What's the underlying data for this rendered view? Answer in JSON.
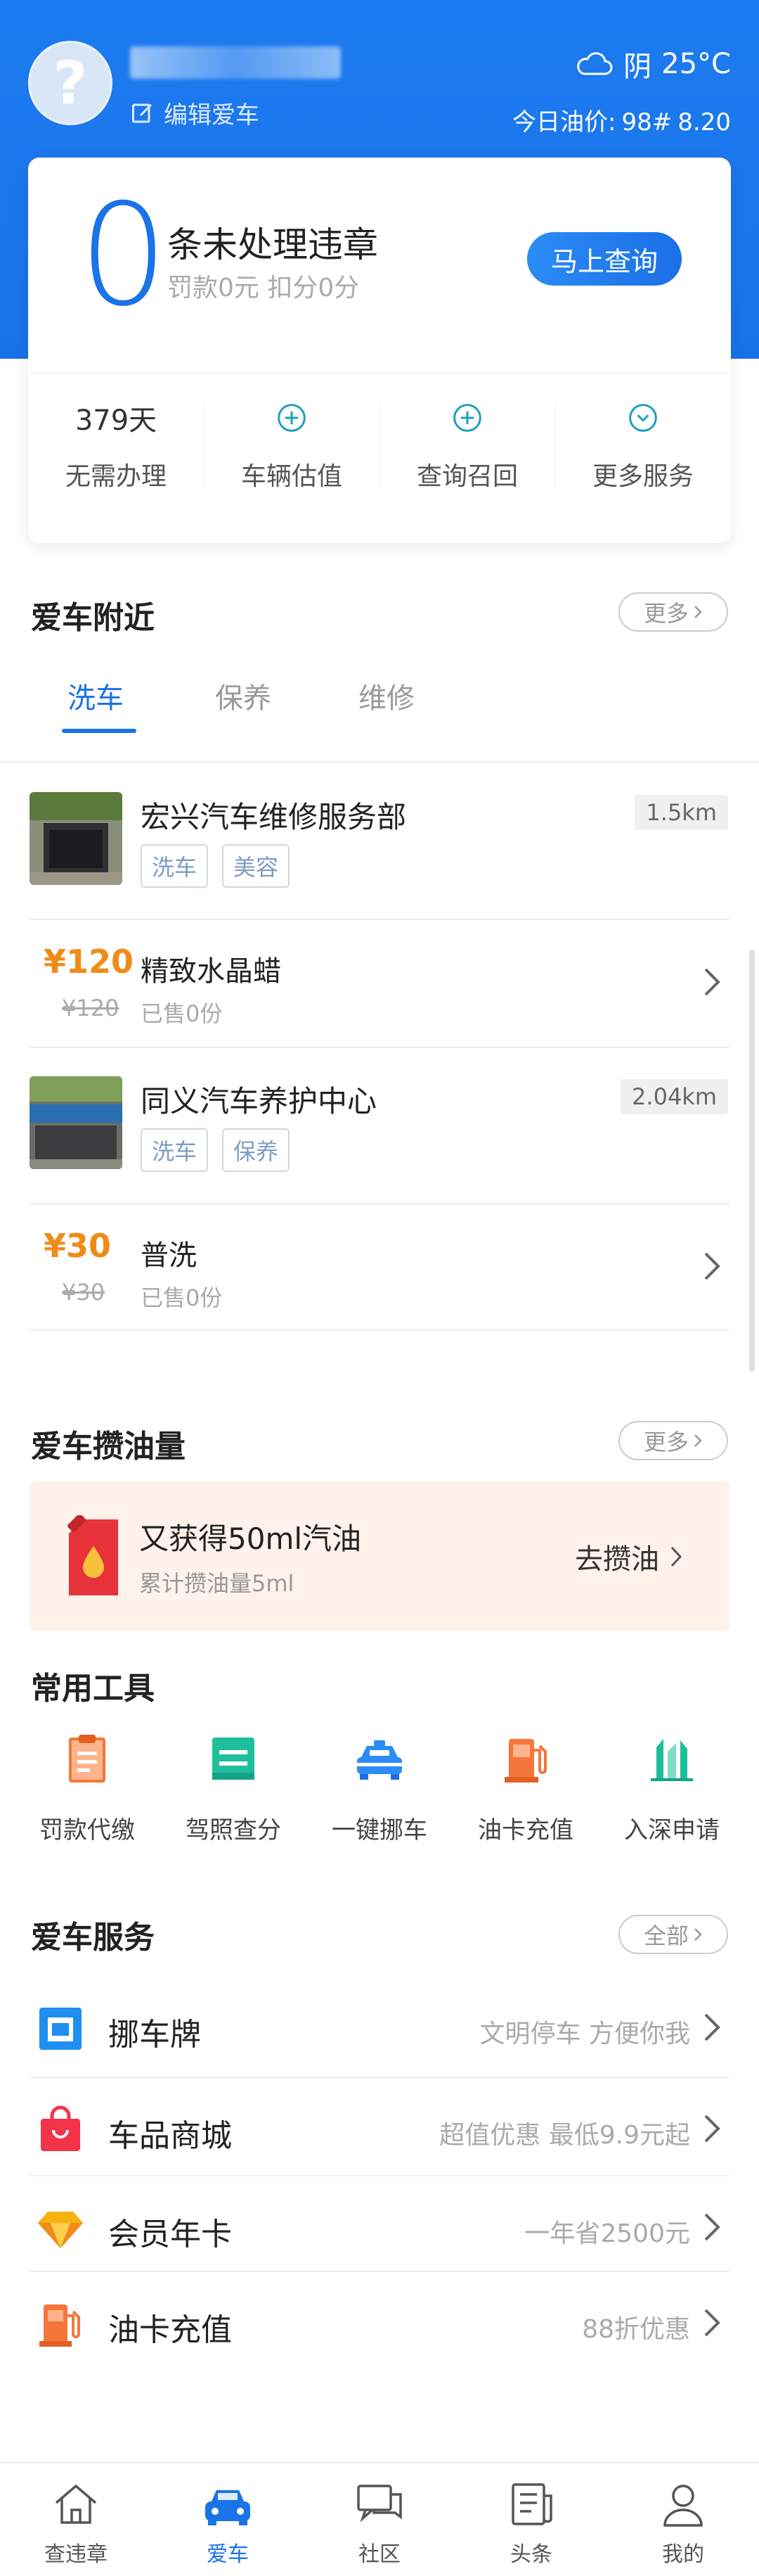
{
  "header": {
    "avatar_glyph": "?",
    "edit_label": "编辑爱车",
    "weather": {
      "condition": "阴",
      "temp": "25°C"
    },
    "oil_price": {
      "label": "今日油价:",
      "grade": "98#",
      "price": "8.20"
    }
  },
  "violation": {
    "count": "0",
    "title": "条未处理违章",
    "fine_summary": "罚款0元 扣分0分",
    "query_button": "马上查询",
    "quick": [
      {
        "top": "379天",
        "label": "无需办理"
      },
      {
        "top": "",
        "label": "车辆估值",
        "icon": "plus-circle-icon"
      },
      {
        "top": "",
        "label": "查询召回",
        "icon": "plus-circle-icon"
      },
      {
        "top": "",
        "label": "更多服务",
        "icon": "chevron-circle-icon"
      }
    ]
  },
  "nearby": {
    "title": "爱车附近",
    "more": "更多",
    "tabs": [
      "洗车",
      "保养",
      "维修"
    ],
    "active_tab": 0,
    "shops": [
      {
        "name": "宏兴汽车维修服务部",
        "distance": "1.5km",
        "tags": [
          "洗车",
          "美容"
        ],
        "deal": {
          "price": "¥120",
          "original": "¥120",
          "name": "精致水晶蜡",
          "sold": "已售0份"
        }
      },
      {
        "name": "同义汽车养护中心",
        "distance": "2.04km",
        "tags": [
          "洗车",
          "保养"
        ],
        "deal": {
          "price": "¥30",
          "original": "¥30",
          "name": "普洗",
          "sold": "已售0份"
        }
      }
    ]
  },
  "oil_saving": {
    "title": "爱车攒油量",
    "more": "更多",
    "banner_title": "又获得50ml汽油",
    "banner_sub": "累计攒油量5ml",
    "go": "去攒油"
  },
  "tools": {
    "title": "常用工具",
    "items": [
      {
        "label": "罚款代缴",
        "icon": "clipboard-icon",
        "color": "#f5753b"
      },
      {
        "label": "驾照查分",
        "icon": "license-card-icon",
        "color": "#1ebf9c"
      },
      {
        "label": "一键挪车",
        "icon": "police-car-icon",
        "color": "#2b8cf5"
      },
      {
        "label": "油卡充值",
        "icon": "fuel-pump-icon",
        "color": "#f5753b"
      },
      {
        "label": "入深申请",
        "icon": "city-icon",
        "color": "#1ebf9c"
      }
    ]
  },
  "services": {
    "title": "爱车服务",
    "more": "全部",
    "items": [
      {
        "name": "挪车牌",
        "hint": "文明停车 方便你我",
        "icon": "plate-icon"
      },
      {
        "name": "车品商城",
        "hint": "超值优惠 最低9.9元起",
        "icon": "shopping-bag-icon"
      },
      {
        "name": "会员年卡",
        "hint": "一年省2500元",
        "icon": "diamond-icon"
      },
      {
        "name": "油卡充值",
        "hint": "88折优惠",
        "icon": "fuel-pump-icon"
      }
    ]
  },
  "tabbar": {
    "items": [
      {
        "label": "查违章",
        "icon": "home-icon"
      },
      {
        "label": "爱车",
        "icon": "car-icon"
      },
      {
        "label": "社区",
        "icon": "chat-icon"
      },
      {
        "label": "头条",
        "icon": "news-icon"
      },
      {
        "label": "我的",
        "icon": "person-icon"
      }
    ],
    "active": 1
  },
  "colors": {
    "brand": "#1a73e8",
    "price": "#f08b19",
    "oil_banner_bg": "#fff2ea"
  }
}
